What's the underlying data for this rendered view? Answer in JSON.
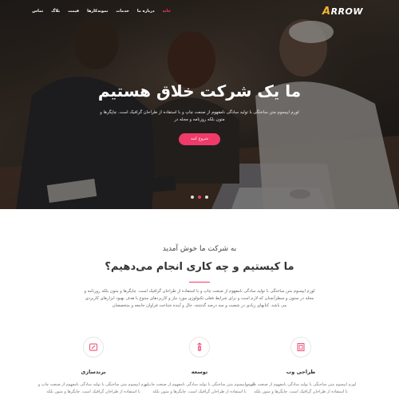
{
  "brand": {
    "logo_first": "A",
    "logo_rest": "RROW"
  },
  "nav": {
    "items": [
      {
        "label": "خانه",
        "active": true
      },
      {
        "label": "درباره ما",
        "active": false
      },
      {
        "label": "خدمات",
        "active": false
      },
      {
        "label": "نمونه‌کارها",
        "active": false
      },
      {
        "label": "قیمت",
        "active": false
      },
      {
        "label": "بلاگ",
        "active": false
      },
      {
        "label": "تماس",
        "active": false
      }
    ]
  },
  "hero": {
    "title": "ما یک شرکت خلاق هستیم",
    "text": "لورم ایپسوم متن ساختگی با تولید سادگی نامفهوم از صنعت چاپ و با استفاده از طراحان گرافیک است. چاپگرها و متون بلکه روزنامه و مجله در",
    "button": "شروع کنید",
    "slides": 3,
    "active_slide": 2
  },
  "about": {
    "subtitle": "به شرکت ما خوش آمدید",
    "title": "ما کیستیم و چه کاری انجام می‌دهیم؟",
    "text": "لورم ایپسوم متن ساختگی با تولید سادگی نامفهوم از صنعت چاپ و با استفاده از طراحان گرافیک است. چاپگرها و متون بلکه روزنامه و مجله در ستون و سطرآنچنان که لازم است و برای شرایط فعلی تکنولوژی مورد نیاز و کاربردهای متنوع با هدف بهبود ابزارهای کاربردی می باشد. کتابهای زیادی در شصت و سه درصد گذشته، حال و آینده شناخت فراوان جامعه و متخصصان"
  },
  "services": [
    {
      "icon": "web-design-icon",
      "title": "طراحی وب",
      "text": "لورم ایپسوم متن ساختگی با تولید سادگی نامفهوم از صنعت چاپ و با استفاده از طراحان گرافیک است. چاپگرها و متون بلکه"
    },
    {
      "icon": "development-icon",
      "title": "توسعه",
      "text": "لورم ایپسوم متن ساختگی با تولید سادگی نامفهوم از صنعت چاپ و با استفاده از طراحان گرافیک است. چاپگرها و متون بلکه"
    },
    {
      "icon": "branding-icon",
      "title": "برندسازی",
      "text": "لورم ایپسوم متن ساختگی با تولید سادگی نامفهوم از صنعت چاپ و با استفاده از طراحان گرافیک است. چاپگرها و متون بلکه"
    }
  ],
  "colors": {
    "accent": "#ef3a6a",
    "logo_accent": "#f5b335"
  }
}
